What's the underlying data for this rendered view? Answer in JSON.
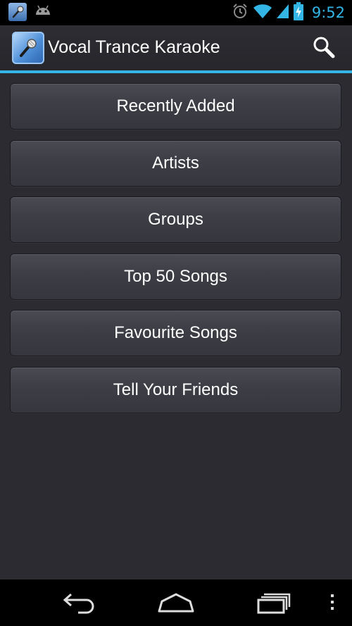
{
  "status_bar": {
    "time": "9:52",
    "icons": [
      "microphone-app-icon",
      "android-debug-icon",
      "alarm-icon",
      "wifi-icon",
      "signal-icon",
      "battery-charging-icon"
    ]
  },
  "action_bar": {
    "title": "Vocal Trance Karaoke",
    "app_icon": "microphone-icon",
    "search_icon": "search-icon"
  },
  "menu": {
    "items": [
      {
        "label": "Recently Added"
      },
      {
        "label": "Artists"
      },
      {
        "label": "Groups"
      },
      {
        "label": "Top 50 Songs"
      },
      {
        "label": "Favourite Songs"
      },
      {
        "label": "Tell Your Friends"
      }
    ]
  },
  "nav_bar": {
    "icons": [
      "back-icon",
      "home-icon",
      "recent-apps-icon",
      "overflow-menu-icon"
    ]
  },
  "colors": {
    "accent": "#33b5e5",
    "background": "#2b2b31",
    "button": "#3f3f47"
  }
}
